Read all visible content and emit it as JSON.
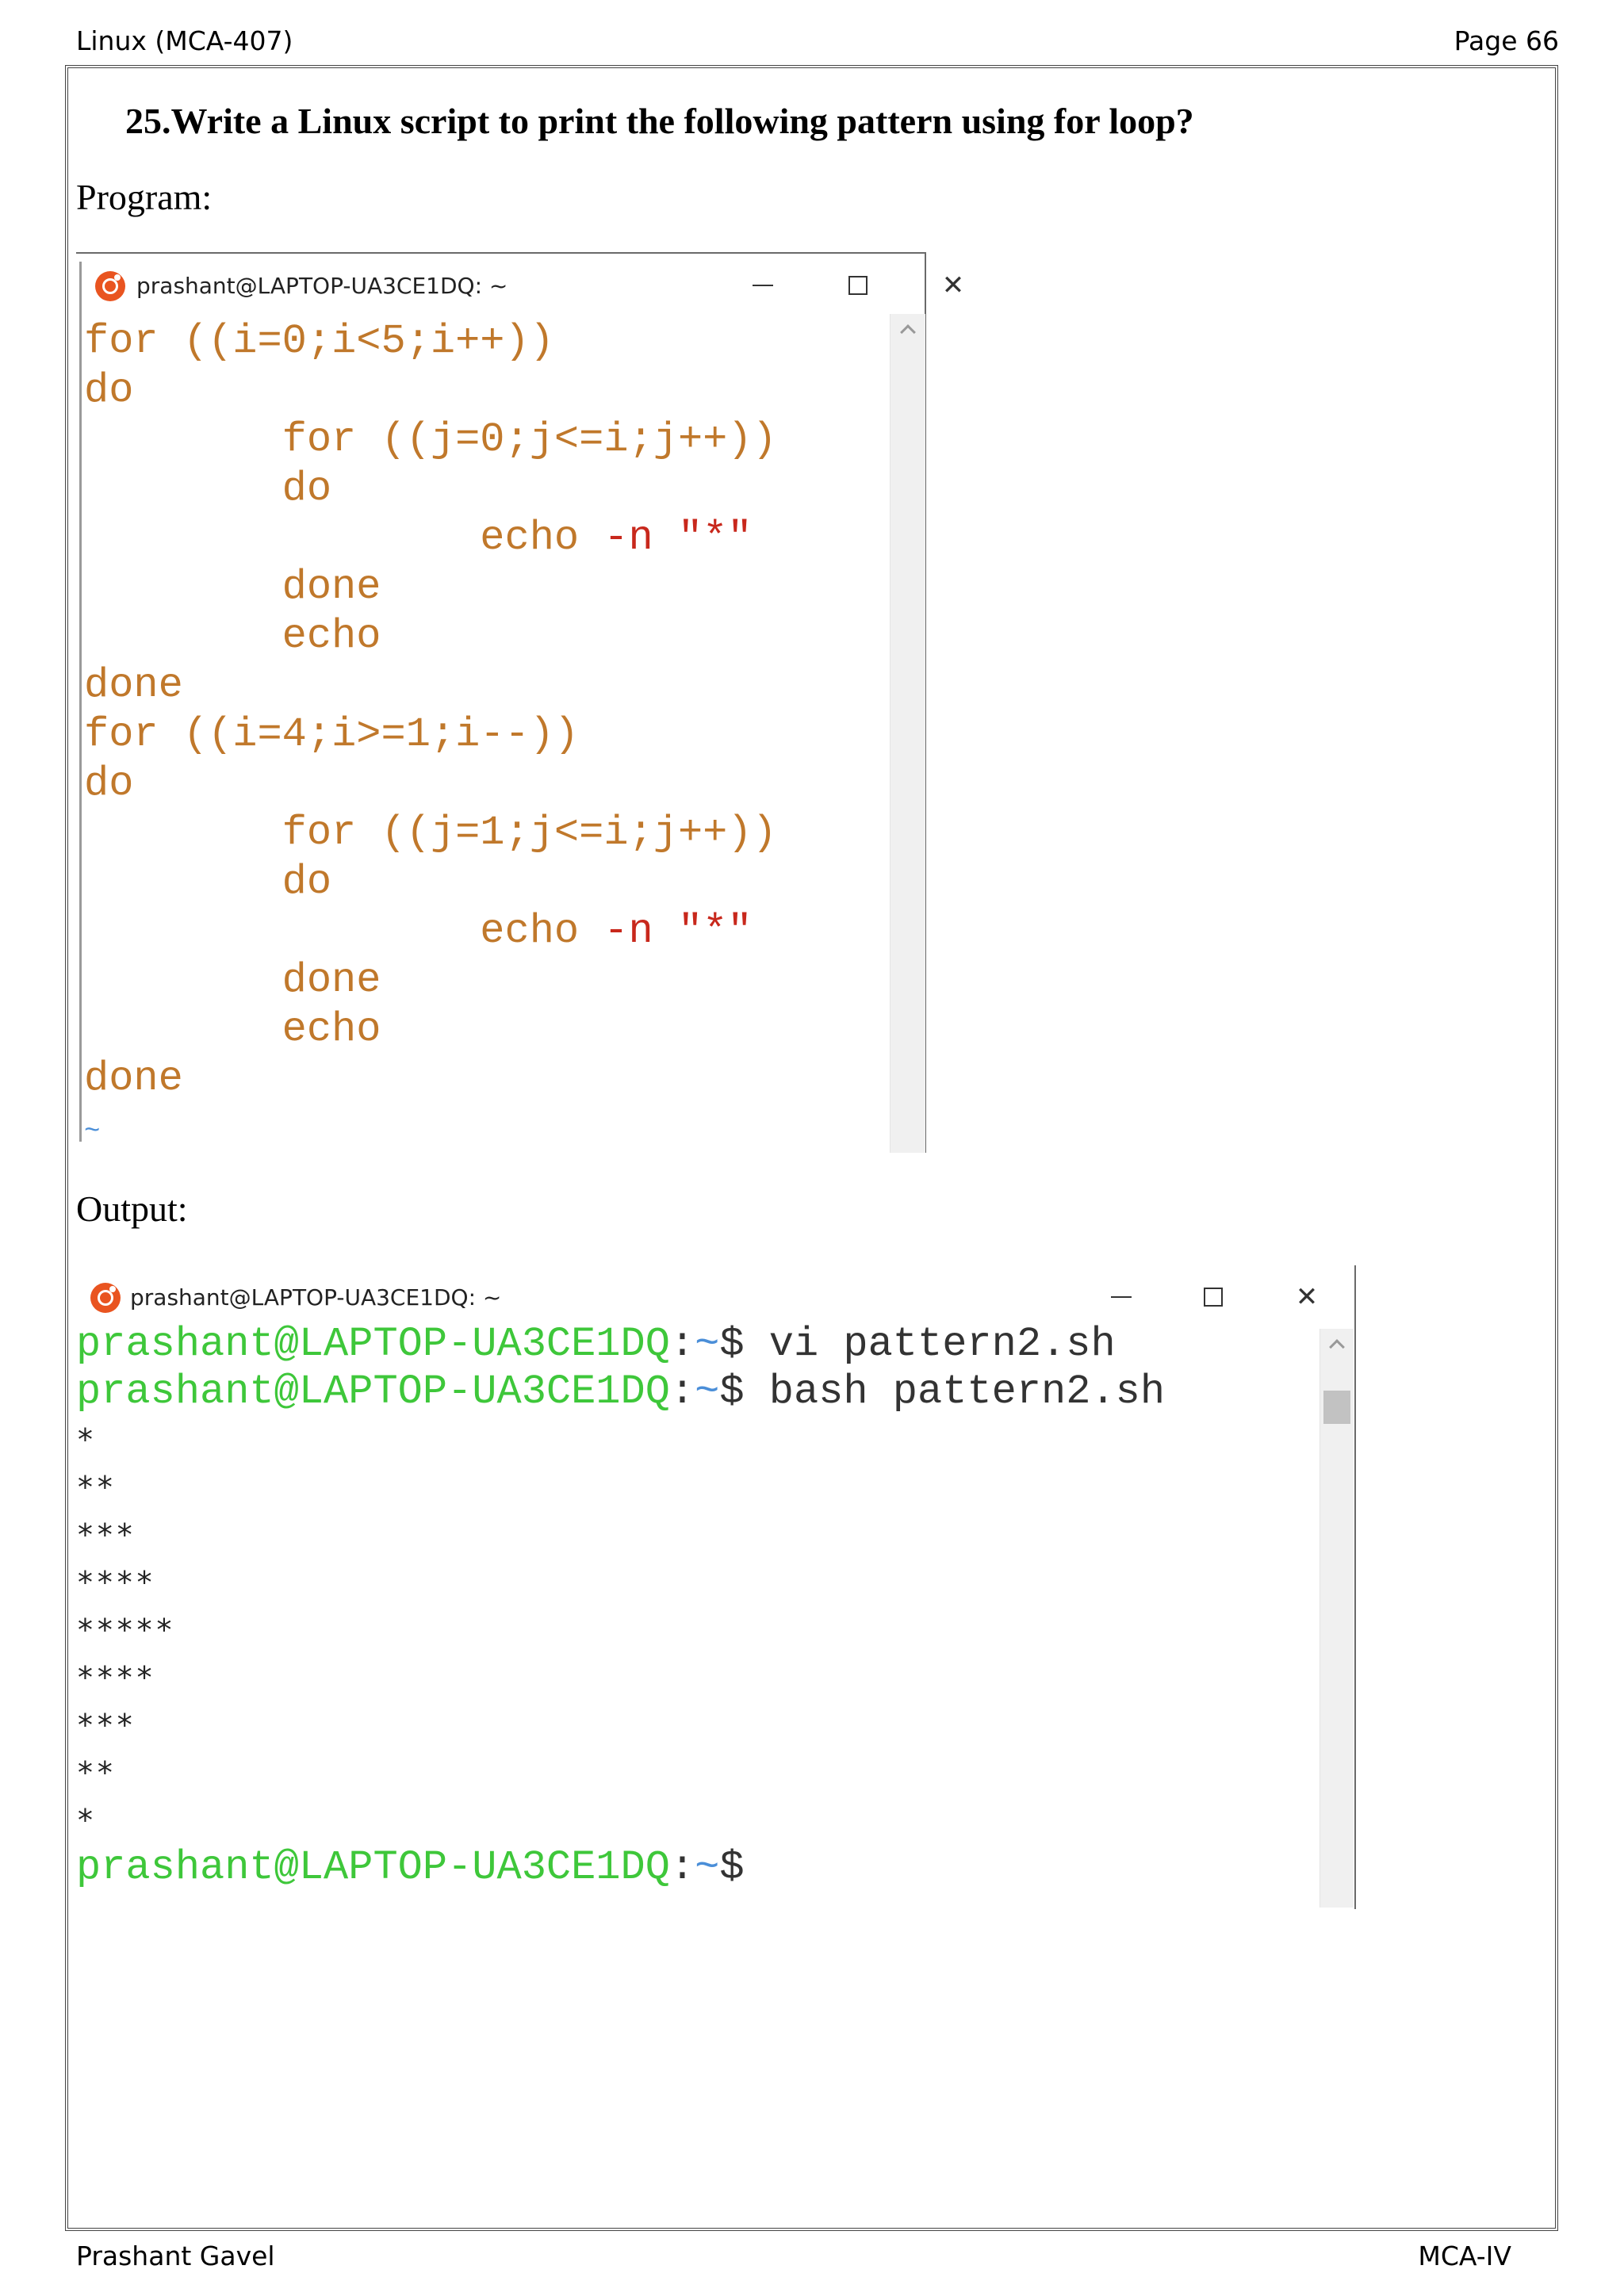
{
  "header": {
    "course": "Linux (MCA-407)",
    "page": "Page 66"
  },
  "question": "25.Write a Linux script to print the following pattern using for loop?",
  "program_label": "Program:",
  "output_label": "Output:",
  "program_window": {
    "title": "prashant@LAPTOP-UA3CE1DQ: ~",
    "code": {
      "l1_kw": "for",
      "l1_rest": "((i=0;i<5;i++))",
      "l2": "do",
      "l3_kw": "for",
      "l3_rest": "((j=0;j<=i;j++))",
      "l4": "do",
      "l5_cmd": "echo",
      "l5_flag": "-n",
      "l5_str": "\"*\"",
      "l6": "done",
      "l7": "echo",
      "l8": "done",
      "l9_kw": "for",
      "l9_rest": "((i=4;i>=1;i--))",
      "l10": "do",
      "l11_kw": "for",
      "l11_rest": "((j=1;j<=i;j++))",
      "l12": "do",
      "l13_cmd": "echo",
      "l13_flag": "-n",
      "l13_str": "\"*\"",
      "l14": "done",
      "l15": "echo",
      "l16": "done",
      "l17": "~"
    }
  },
  "output_window": {
    "title": "prashant@LAPTOP-UA3CE1DQ: ~",
    "prompt_user": "prashant@LAPTOP-UA3CE1DQ",
    "prompt_colon": ":",
    "prompt_path": "~",
    "prompt_dollar": "$",
    "cmd1": " vi pattern2.sh",
    "cmd2": " bash pattern2.sh",
    "stars": [
      "*",
      "**",
      "***",
      "****",
      "*****",
      "****",
      "***",
      "**",
      "*"
    ]
  },
  "footer": {
    "author": "Prashant Gavel",
    "class": "MCA-IV"
  }
}
